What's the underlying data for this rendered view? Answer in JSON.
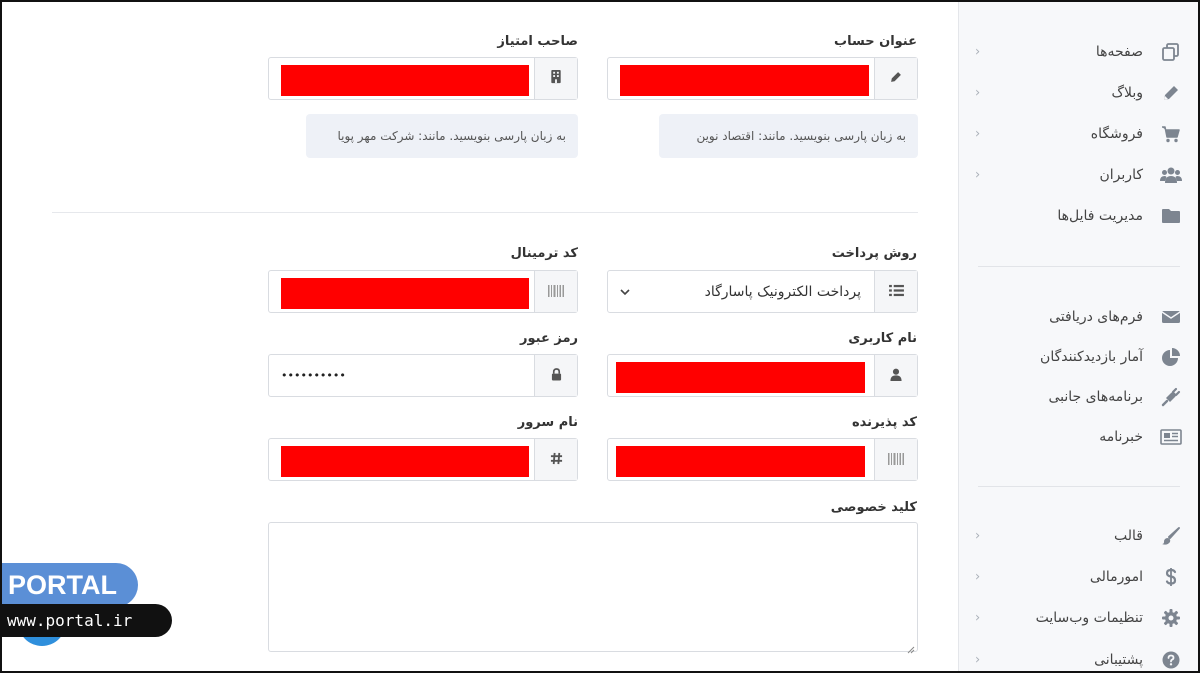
{
  "sidebar": {
    "group1": [
      {
        "label": "صفحه‌ها",
        "icon": "pages-icon",
        "has_submenu": true
      },
      {
        "label": "وبلاگ",
        "icon": "pencil-icon",
        "has_submenu": true
      },
      {
        "label": "فروشگاه",
        "icon": "cart-icon",
        "has_submenu": true
      },
      {
        "label": "کاربران",
        "icon": "users-icon",
        "has_submenu": true
      },
      {
        "label": "مدیریت فایل‌ها",
        "icon": "folder-icon",
        "has_submenu": false
      }
    ],
    "group2": [
      {
        "label": "فرم‌های دریافتی",
        "icon": "envelope-icon",
        "has_submenu": false
      },
      {
        "label": "آمار بازدیدکنندگان",
        "icon": "pie-chart-icon",
        "has_submenu": false
      },
      {
        "label": "برنامه‌های جانبی",
        "icon": "plug-icon",
        "has_submenu": false
      },
      {
        "label": "خبرنامه",
        "icon": "newspaper-icon",
        "has_submenu": false
      }
    ],
    "group3": [
      {
        "label": "قالب",
        "icon": "brush-icon",
        "has_submenu": true
      },
      {
        "label": "امورمالی",
        "icon": "dollar-icon",
        "has_submenu": true
      },
      {
        "label": "تنظیمات وب‌سایت",
        "icon": "gear-icon",
        "has_submenu": true
      },
      {
        "label": "پشتیبانی",
        "icon": "question-icon",
        "has_submenu": true
      }
    ],
    "chevron": "›"
  },
  "form": {
    "account_title": {
      "label": "عنوان حساب",
      "hint": "به زبان پارسی بنویسید. مانند: اقتصاد نوین"
    },
    "license_owner": {
      "label": "صاحب امتیاز",
      "hint": "به زبان پارسی بنویسید. مانند: شرکت مهر پویا"
    },
    "payment_method": {
      "label": "روش پرداخت",
      "value": "پرداخت الکترونیک پاسارگاد"
    },
    "terminal_code": {
      "label": "کد ترمینال"
    },
    "username": {
      "label": "نام کاربری"
    },
    "password": {
      "label": "رمز عبور",
      "value": "••••••••••"
    },
    "merchant_code": {
      "label": "کد پذیرنده"
    },
    "server_name": {
      "label": "نام سرور"
    },
    "private_key": {
      "label": "کلید خصوصی",
      "value": ""
    }
  },
  "watermark": {
    "brand": "PORTAL",
    "url": "www.portal.ir"
  },
  "colors": {
    "redaction": "#ff0000",
    "addon_bg": "#f5f6f8",
    "hint_bg": "#eef1f7",
    "sidebar_bg": "#f7f8fa"
  }
}
